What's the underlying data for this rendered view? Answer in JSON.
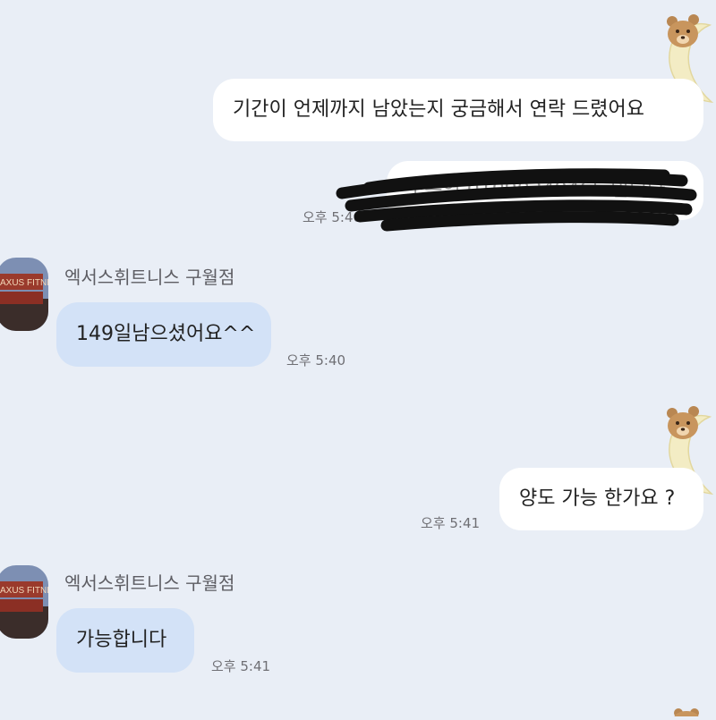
{
  "messages": [
    {
      "id": "m1",
      "side": "me",
      "text": "기간이 언제까지 남았는지 궁금해서 연락 드렸어요"
    },
    {
      "id": "m2",
      "side": "me",
      "text": "조은영 01090249465 입니다",
      "time": "오후 5:40",
      "redacted": true
    },
    {
      "id": "m3",
      "side": "them",
      "sender": "엑서스휘트니스 구월점",
      "text": "149일남으셨어요^^",
      "time": "오후 5:40"
    },
    {
      "id": "m4",
      "side": "me",
      "text": "양도 가능 한가요 ?",
      "time": "오후 5:41"
    },
    {
      "id": "m5",
      "side": "them",
      "sender": "엑서스휘트니스 구월점",
      "text": "가능합니다",
      "time": "오후 5:41"
    }
  ],
  "avatar": {
    "icon": "gym-sign-avatar",
    "sign_text": "AXUS FITNESS"
  },
  "stickers": {
    "icon": "bear-on-moon-sticker"
  },
  "colors": {
    "background": "#e9eef6",
    "my_bubble": "#ffffff",
    "their_bubble": "#d3e2f7",
    "time_text": "#6f6f74",
    "redaction": "#111111"
  }
}
